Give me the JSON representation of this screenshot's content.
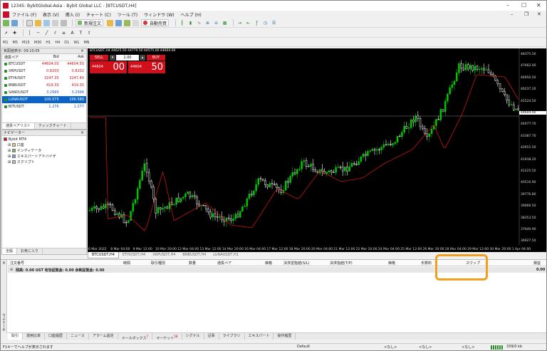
{
  "window": {
    "title": "12345: BybitGlobal-Asia - Bybit Global LLC - [BTCUSDT,H4]",
    "controls": [
      "–",
      "☐",
      "✕"
    ]
  },
  "menu": [
    "ファイル (F)",
    "表示 (V)",
    "挿入 (I)",
    "チャート (C)",
    "ツール (T)",
    "ウィンドウ (W)",
    "ヘルプ (H)"
  ],
  "mdi_controls": [
    "–",
    "❐",
    "✕"
  ],
  "toolbar": {
    "new_order": "新規注文",
    "auto_trade": "自動売買"
  },
  "timeframes": [
    "M1",
    "M5",
    "M15",
    "M30",
    "H1",
    "H4",
    "D1",
    "W1",
    "MN"
  ],
  "market_watch": {
    "title": "気配値表示: 09:10:05",
    "columns": [
      "通貨ペア",
      "Bid",
      "Ask"
    ],
    "rows": [
      {
        "symbol": "BTCUSDT",
        "bid": "44604.00",
        "ask": "44604.50",
        "selected": false
      },
      {
        "symbol": "XRPUSDT",
        "bid": "0.8200",
        "ask": "0.8202",
        "selected": false
      },
      {
        "symbol": "ETHUSDT",
        "bid": "3247.35",
        "ask": "3247.40",
        "selected": false
      },
      {
        "symbol": "BNBUSDT",
        "bid": "419.30",
        "ask": "419.35",
        "selected": false
      },
      {
        "symbol": "SANDUSDT",
        "bid": "3.2995",
        "ask": "3.2996",
        "selected": false
      },
      {
        "symbol": "LUNAUSDT",
        "bid": "100.575",
        "ask": "100.580",
        "selected": true
      },
      {
        "symbol": "BITUSDT",
        "bid": "1.276",
        "ask": "1.277",
        "selected": false
      }
    ],
    "tabs": [
      "通貨ペアリスト",
      "ティックチャート"
    ]
  },
  "navigator": {
    "title": "ナビゲーター",
    "items": [
      "Bybit MT4",
      "口座",
      "インディケータ",
      "エキスパートアドバイザ",
      "スクリプト"
    ],
    "tabs": [
      "全般",
      "お気に入り"
    ]
  },
  "chart": {
    "header": "BTCUSDT,H4  44625.50 44779.50 44575.00 44604.00",
    "one_click": {
      "sell": "SELL",
      "buy": "BUY",
      "lot": "1.00",
      "sell_small": "44604",
      "sell_big": "00",
      "buy_small": "44604",
      "buy_big": "50"
    },
    "price_ticks": [
      "48375.50",
      "47662.00",
      "46950.50",
      "46237.20",
      "45524.50",
      "44604.00",
      "44077.70",
      "43387.70",
      "42651.50",
      "41938.20",
      "41225.50",
      "40510.90",
      "39776.80",
      "39066.50",
      "38353.50",
      "37640.90",
      "36927.50"
    ],
    "current_price": "44604.00",
    "time_ticks": [
      "6 Mar 2022",
      "8 Mar 04:00",
      "9 Mar 12:00",
      "10 Mar 20:00",
      "12 Mar 04:00",
      "13 Mar 12:00",
      "14 Mar 20:00",
      "16 Mar 04:00",
      "17 Mar 12:00",
      "18 Mar 20:00",
      "20 Mar 04:00",
      "21 Mar 12:00",
      "22 Mar 20:00",
      "24 Mar 04:00",
      "25 Mar 12:00",
      "26 Mar 20:00",
      "28 Mar 04:00",
      "29 Mar 12:00",
      "30 Mar 20:00",
      "1 Apr 04:00"
    ],
    "tabs": [
      "BTCUSDT,H4",
      "ETHUSDT,H4",
      "XRPUSDT,H4",
      "BNBUSDT,H4",
      "LUNAUSDT,H1"
    ]
  },
  "terminal": {
    "side_label": "ターミナル",
    "columns": [
      "注文番号",
      "時間",
      "取引種別",
      "数量",
      "通貨ペア",
      "価格",
      "決済逆指値(S/L)",
      "決済指値(T/P)",
      "価格",
      "手数料",
      "スワップ",
      "損益"
    ],
    "balance_row": "残高: 0.00 UST  有効証拠金: 0.00  余剰証拠金: 0.00",
    "balance_profit": "0.00",
    "tabs": [
      "取引",
      "運用比率",
      "口座履歴",
      "ニュース",
      "アラーム設定",
      "メールボックス",
      "マーケット",
      "シグナル",
      "記事",
      "ライブラリ",
      "エキスパート",
      "操作履歴"
    ],
    "mailbox_badge": "7",
    "market_badge": "58"
  },
  "status_bar": {
    "help": "F1キーでヘルプが表示されます",
    "profile": "Default",
    "f1": "<なし>",
    "f2": "<なし>",
    "f3": "<なし>",
    "traffic": "339/0 kb"
  },
  "colors": {
    "bull": "#00c800",
    "bear": "#ffffff",
    "ma": "#c81414",
    "highlight": "#f0a020",
    "sell": "#d0101a"
  }
}
